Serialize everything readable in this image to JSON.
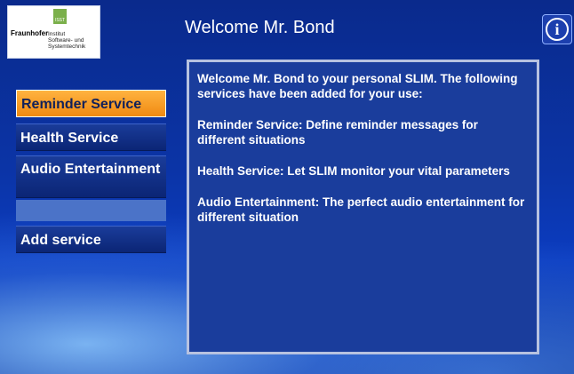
{
  "logo": {
    "badge": "ISST",
    "brand": "Fraunhofer",
    "institute_lines": [
      "Institut",
      "Software- und",
      "Systemtechnik"
    ]
  },
  "header": {
    "title": "Welcome Mr. Bond",
    "info_icon": "info-icon"
  },
  "nav": {
    "items": [
      {
        "label": "Reminder Service",
        "active": true
      },
      {
        "label": "Health Service",
        "active": false
      },
      {
        "label": "Audio Entertainment",
        "active": false
      },
      {
        "label": "",
        "active": false
      },
      {
        "label": "Add service",
        "active": false
      }
    ]
  },
  "content": {
    "paragraphs": [
      "Welcome Mr. Bond to your personal SLIM. The following services have been added for your use:",
      "Reminder Service: Define reminder messages for different situations",
      "Health Service: Let SLIM monitor your vital parameters",
      "Audio Entertainment: The perfect audio entertainment for different situation"
    ]
  },
  "colors": {
    "active_item": "#f39a1e",
    "background": "#0b34a6",
    "panel": "#1a3d9c"
  }
}
